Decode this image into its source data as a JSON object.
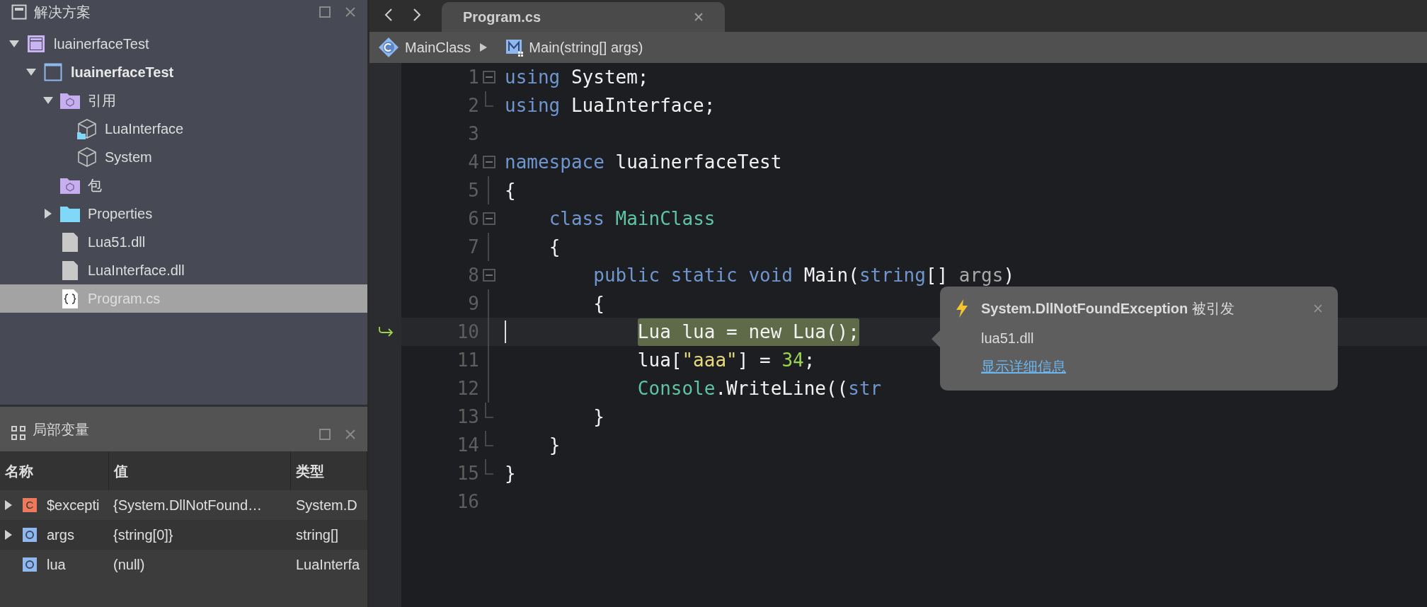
{
  "solution_panel": {
    "title": "解决方案",
    "tree": [
      {
        "label": "luainerfaceTest",
        "kind": "solution",
        "expanded": true,
        "selected": false,
        "children": [
          {
            "label": "luainerfaceTest",
            "kind": "project",
            "expanded": true,
            "selected": false,
            "children": [
              {
                "label": "引用",
                "kind": "references",
                "expanded": true,
                "selected": false,
                "children": [
                  {
                    "label": "LuaInterface",
                    "kind": "assembly-local",
                    "selected": false
                  },
                  {
                    "label": "System",
                    "kind": "assembly",
                    "selected": false
                  }
                ]
              },
              {
                "label": "包",
                "kind": "packages",
                "selected": false
              },
              {
                "label": "Properties",
                "kind": "folder",
                "expanded": false,
                "selected": false
              },
              {
                "label": "Lua51.dll",
                "kind": "file",
                "selected": false
              },
              {
                "label": "LuaInterface.dll",
                "kind": "file",
                "selected": false
              },
              {
                "label": "Program.cs",
                "kind": "csfile",
                "selected": true
              }
            ]
          }
        ]
      }
    ]
  },
  "locals_panel": {
    "title": "局部变量",
    "columns": [
      "名称",
      "值",
      "类型"
    ],
    "rows": [
      {
        "expandable": true,
        "kind": "class",
        "icon_text": "C",
        "name": "$excepti",
        "value": "{System.DllNotFound…",
        "type": "System.D"
      },
      {
        "expandable": true,
        "kind": "object",
        "name": "args",
        "value": "{string[0]}",
        "type": "string[]"
      },
      {
        "expandable": false,
        "kind": "object",
        "name": "lua",
        "value": "(null)",
        "type": "LuaInterfa"
      }
    ]
  },
  "editor": {
    "tab": {
      "label": "Program.cs",
      "selected": true
    },
    "breadcrumb": [
      {
        "label": "MainClass",
        "kind": "class"
      },
      {
        "label": "Main(string[] args)",
        "kind": "method"
      }
    ],
    "lines": [
      {
        "number": "1",
        "fold_box": true,
        "fold_guide": false,
        "fold_end": false,
        "tokens": [
          {
            "kind": "keyword",
            "text": "using"
          },
          {
            "kind": "plain",
            "text": " System;"
          }
        ]
      },
      {
        "number": "2",
        "fold_box": false,
        "fold_guide": false,
        "fold_end": true,
        "tokens": [
          {
            "kind": "keyword",
            "text": "using"
          },
          {
            "kind": "plain",
            "text": " LuaInterface;"
          }
        ]
      },
      {
        "number": "3",
        "fold_box": false,
        "fold_guide": false,
        "fold_end": false
      },
      {
        "number": "4",
        "fold_box": true,
        "fold_guide": false,
        "fold_end": false,
        "tokens": [
          {
            "kind": "keyword",
            "text": "namespace"
          },
          {
            "kind": "plain",
            "text": " luainerfaceTest"
          }
        ]
      },
      {
        "number": "5",
        "fold_box": false,
        "fold_guide": true,
        "fold_end": false,
        "tokens": [
          {
            "kind": "plain",
            "text": "{"
          }
        ]
      },
      {
        "number": "6",
        "fold_box": true,
        "fold_guide": false,
        "fold_end": false,
        "tokens": [
          {
            "kind": "keyword",
            "text": "    class"
          },
          {
            "kind": "type",
            "text": " MainClass"
          }
        ]
      },
      {
        "number": "7",
        "fold_box": false,
        "fold_guide": true,
        "fold_end": false,
        "tokens": [
          {
            "kind": "plain",
            "text": "    {"
          }
        ]
      },
      {
        "number": "8",
        "fold_box": true,
        "fold_guide": false,
        "fold_end": false,
        "tokens": [
          {
            "kind": "keyword",
            "text": "        public static void"
          },
          {
            "kind": "plain",
            "text": " Main("
          },
          {
            "kind": "keyword",
            "text": "string"
          },
          {
            "kind": "plain",
            "text": "[] "
          },
          {
            "kind": "param",
            "text": "args"
          },
          {
            "kind": "plain",
            "text": ")"
          }
        ]
      },
      {
        "number": "9",
        "fold_box": false,
        "fold_guide": true,
        "fold_end": false,
        "tokens": [
          {
            "kind": "plain",
            "text": "        {"
          }
        ]
      },
      {
        "number": "10",
        "fold_box": false,
        "fold_guide": true,
        "fold_end": false,
        "current": true,
        "tokens": [
          {
            "kind": "plain",
            "text": "            Lua lua = new Lua();"
          }
        ]
      },
      {
        "number": "11",
        "fold_box": false,
        "fold_guide": true,
        "fold_end": false,
        "tokens": [
          {
            "kind": "plain",
            "text": "            lua["
          },
          {
            "kind": "string",
            "text": "\"aaa\""
          },
          {
            "kind": "plain",
            "text": "] = "
          },
          {
            "kind": "number",
            "text": "34"
          },
          {
            "kind": "plain",
            "text": ";"
          }
        ]
      },
      {
        "number": "12",
        "fold_box": false,
        "fold_guide": true,
        "fold_end": false,
        "tokens": [
          {
            "kind": "type",
            "text": "            Console"
          },
          {
            "kind": "plain",
            "text": ".WriteLine(("
          },
          {
            "kind": "keyword",
            "text": "str"
          }
        ]
      },
      {
        "number": "13",
        "fold_box": false,
        "fold_guide": false,
        "fold_end": true,
        "tokens": [
          {
            "kind": "plain",
            "text": "        }"
          }
        ]
      },
      {
        "number": "14",
        "fold_box": false,
        "fold_guide": false,
        "fold_end": true,
        "tokens": [
          {
            "kind": "plain",
            "text": "    }"
          }
        ]
      },
      {
        "number": "15",
        "fold_box": false,
        "fold_guide": false,
        "fold_end": true,
        "tokens": [
          {
            "kind": "plain",
            "text": "}"
          }
        ]
      },
      {
        "number": "16",
        "fold_box": false,
        "fold_guide": false,
        "fold_end": false
      }
    ]
  },
  "exception_popup": {
    "title": "**System.DllNotFoundException** 被引发",
    "message": "lua51.dll",
    "link": "显示详细信息"
  }
}
